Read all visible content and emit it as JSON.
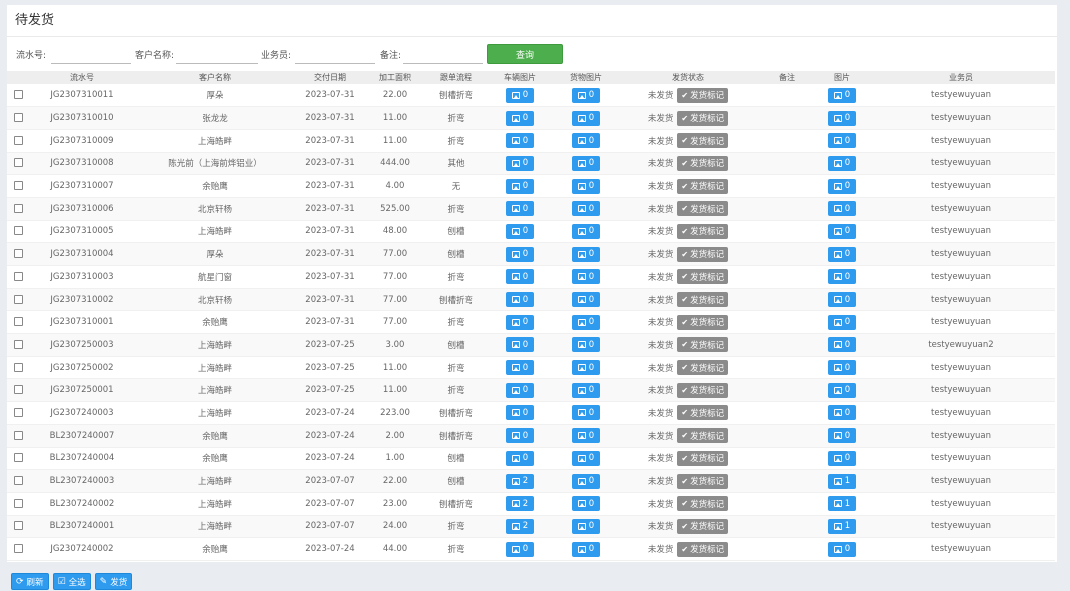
{
  "panel": {
    "title": "待发货"
  },
  "search": {
    "serial_label": "流水号:",
    "customer_label": "客户名称:",
    "salesman_label": "业务员:",
    "remark_label": "备注:",
    "query_label": "查询"
  },
  "table": {
    "headers": [
      "",
      "流水号",
      "客户名称",
      "交付日期",
      "加工面积",
      "跟单流程",
      "车辆图片",
      "货物图片",
      "发货状态",
      "备注",
      "图片",
      "业务员"
    ],
    "status_text": "未发货",
    "mark_label": "发货标记",
    "rows": [
      {
        "serial": "JG2307310011",
        "customer": "厚朵",
        "date": "2023-07-31",
        "area": "22.00",
        "flow": "刨槽折弯",
        "vehicle": "0",
        "goods": "0",
        "pic": "0",
        "salesman": "testyewuyuan"
      },
      {
        "serial": "JG2307310010",
        "customer": "张龙龙",
        "date": "2023-07-31",
        "area": "11.00",
        "flow": "折弯",
        "vehicle": "0",
        "goods": "0",
        "pic": "0",
        "salesman": "testyewuyuan"
      },
      {
        "serial": "JG2307310009",
        "customer": "上海皓畔",
        "date": "2023-07-31",
        "area": "11.00",
        "flow": "折弯",
        "vehicle": "0",
        "goods": "0",
        "pic": "0",
        "salesman": "testyewuyuan"
      },
      {
        "serial": "JG2307310008",
        "customer": "陈光前（上海前烨铝业）",
        "date": "2023-07-31",
        "area": "444.00",
        "flow": "其他",
        "vehicle": "0",
        "goods": "0",
        "pic": "0",
        "salesman": "testyewuyuan"
      },
      {
        "serial": "JG2307310007",
        "customer": "余贻鹰",
        "date": "2023-07-31",
        "area": "4.00",
        "flow": "无",
        "vehicle": "0",
        "goods": "0",
        "pic": "0",
        "salesman": "testyewuyuan"
      },
      {
        "serial": "JG2307310006",
        "customer": "北京轩杨",
        "date": "2023-07-31",
        "area": "525.00",
        "flow": "折弯",
        "vehicle": "0",
        "goods": "0",
        "pic": "0",
        "salesman": "testyewuyuan"
      },
      {
        "serial": "JG2307310005",
        "customer": "上海皓畔",
        "date": "2023-07-31",
        "area": "48.00",
        "flow": "刨槽",
        "vehicle": "0",
        "goods": "0",
        "pic": "0",
        "salesman": "testyewuyuan"
      },
      {
        "serial": "JG2307310004",
        "customer": "厚朵",
        "date": "2023-07-31",
        "area": "77.00",
        "flow": "刨槽",
        "vehicle": "0",
        "goods": "0",
        "pic": "0",
        "salesman": "testyewuyuan"
      },
      {
        "serial": "JG2307310003",
        "customer": "航星门窗",
        "date": "2023-07-31",
        "area": "77.00",
        "flow": "折弯",
        "vehicle": "0",
        "goods": "0",
        "pic": "0",
        "salesman": "testyewuyuan"
      },
      {
        "serial": "JG2307310002",
        "customer": "北京轩杨",
        "date": "2023-07-31",
        "area": "77.00",
        "flow": "刨槽折弯",
        "vehicle": "0",
        "goods": "0",
        "pic": "0",
        "salesman": "testyewuyuan"
      },
      {
        "serial": "JG2307310001",
        "customer": "余贻鹰",
        "date": "2023-07-31",
        "area": "77.00",
        "flow": "折弯",
        "vehicle": "0",
        "goods": "0",
        "pic": "0",
        "salesman": "testyewuyuan"
      },
      {
        "serial": "JG2307250003",
        "customer": "上海皓畔",
        "date": "2023-07-25",
        "area": "3.00",
        "flow": "刨槽",
        "vehicle": "0",
        "goods": "0",
        "pic": "0",
        "salesman": "testyewuyuan2"
      },
      {
        "serial": "JG2307250002",
        "customer": "上海皓畔",
        "date": "2023-07-25",
        "area": "11.00",
        "flow": "折弯",
        "vehicle": "0",
        "goods": "0",
        "pic": "0",
        "salesman": "testyewuyuan"
      },
      {
        "serial": "JG2307250001",
        "customer": "上海皓畔",
        "date": "2023-07-25",
        "area": "11.00",
        "flow": "折弯",
        "vehicle": "0",
        "goods": "0",
        "pic": "0",
        "salesman": "testyewuyuan"
      },
      {
        "serial": "JG2307240003",
        "customer": "上海皓畔",
        "date": "2023-07-24",
        "area": "223.00",
        "flow": "刨槽折弯",
        "vehicle": "0",
        "goods": "0",
        "pic": "0",
        "salesman": "testyewuyuan"
      },
      {
        "serial": "BL2307240007",
        "customer": "余贻鹰",
        "date": "2023-07-24",
        "area": "2.00",
        "flow": "刨槽折弯",
        "vehicle": "0",
        "goods": "0",
        "pic": "0",
        "salesman": "testyewuyuan"
      },
      {
        "serial": "BL2307240004",
        "customer": "余贻鹰",
        "date": "2023-07-24",
        "area": "1.00",
        "flow": "刨槽",
        "vehicle": "0",
        "goods": "0",
        "pic": "0",
        "salesman": "testyewuyuan"
      },
      {
        "serial": "BL2307240003",
        "customer": "上海皓畔",
        "date": "2023-07-07",
        "area": "22.00",
        "flow": "刨槽",
        "vehicle": "2",
        "goods": "0",
        "pic": "1",
        "salesman": "testyewuyuan"
      },
      {
        "serial": "BL2307240002",
        "customer": "上海皓畔",
        "date": "2023-07-07",
        "area": "23.00",
        "flow": "刨槽折弯",
        "vehicle": "2",
        "goods": "0",
        "pic": "1",
        "salesman": "testyewuyuan"
      },
      {
        "serial": "BL2307240001",
        "customer": "上海皓畔",
        "date": "2023-07-07",
        "area": "24.00",
        "flow": "折弯",
        "vehicle": "2",
        "goods": "0",
        "pic": "1",
        "salesman": "testyewuyuan"
      },
      {
        "serial": "JG2307240002",
        "customer": "余贻鹰",
        "date": "2023-07-24",
        "area": "44.00",
        "flow": "折弯",
        "vehicle": "0",
        "goods": "0",
        "pic": "0",
        "salesman": "testyewuyuan"
      }
    ]
  },
  "actions": {
    "refresh_label": "刷新",
    "select_all_label": "全选",
    "ship_label": "发货"
  },
  "colors": {
    "primary": "#2e9bef",
    "query": "#4cae4c",
    "mark": "#8b8b8b"
  }
}
